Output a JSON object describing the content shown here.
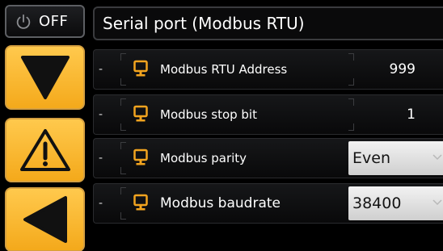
{
  "power": {
    "label": "OFF",
    "icon": "power-icon"
  },
  "nav": {
    "down_icon": "triangle-down-icon",
    "warning_icon": "warning-icon",
    "back_icon": "triangle-left-icon",
    "accent_color": "#f7b32b"
  },
  "header": {
    "title": "Serial port (Modbus RTU)"
  },
  "settings": [
    {
      "dash": "-",
      "icon": "monitor-icon",
      "label": "Modbus RTU Address",
      "value": "999"
    },
    {
      "dash": "-",
      "icon": "monitor-icon",
      "label": "Modbus stop bit",
      "value": "1"
    },
    {
      "dash": "-",
      "icon": "monitor-icon",
      "label": "Modbus parity",
      "value": "Even",
      "control": "dropdown"
    },
    {
      "dash": "-",
      "icon": "monitor-icon",
      "label": "Modbus baudrate",
      "value": "38400",
      "control": "dropdown"
    }
  ]
}
